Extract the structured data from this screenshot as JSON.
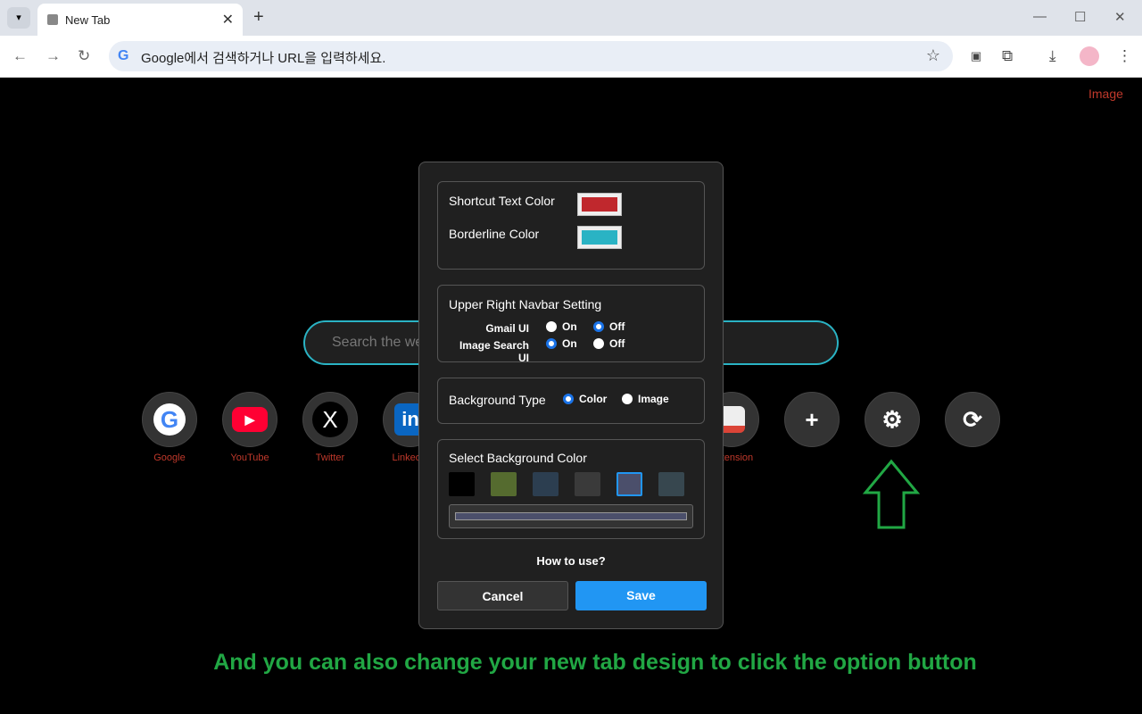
{
  "browser": {
    "tab_title": "New Tab",
    "omnibox_placeholder": "Google에서 검색하거나 URL을 입력하세요."
  },
  "page": {
    "image_link": "Image",
    "search_placeholder": "Search the web",
    "shortcuts": [
      {
        "label": "Google",
        "icon": "G",
        "color": "#fff"
      },
      {
        "label": "YouTube",
        "icon": "▶",
        "color": "#ff0033"
      },
      {
        "label": "Twitter",
        "icon": "X",
        "color": "#000"
      },
      {
        "label": "Linkedin",
        "icon": "in",
        "color": "#0a66c2"
      }
    ],
    "extension_label": "Extension",
    "add_icon": "+",
    "settings_icon": "⚙",
    "refresh_icon": "⟳"
  },
  "modal": {
    "shortcut_text_color_label": "Shortcut Text Color",
    "shortcut_text_color": "#c0282d",
    "borderline_color_label": "Borderline Color",
    "borderline_color": "#2ab3c4",
    "navbar_title": "Upper Right Navbar Setting",
    "gmail_label": "Gmail UI",
    "image_search_label": "Image Search UI",
    "on": "On",
    "off": "Off",
    "gmail_ui": "Off",
    "image_search_ui": "On",
    "background_type_label": "Background Type",
    "bg_color_option": "Color",
    "bg_image_option": "Image",
    "background_type": "Color",
    "select_bg_label": "Select Background Color",
    "swatches": [
      "#000000",
      "#556b2f",
      "#2c3e50",
      "#3a3a3a",
      "#4b4f6b",
      "#37474f"
    ],
    "selected_swatch": "#4b4f6b",
    "how_to": "How to use?",
    "cancel": "Cancel",
    "save": "Save"
  },
  "caption": "And you can also change your new tab design to click the option button",
  "colors": {
    "accent": "#2196f3",
    "annotation": "#21a744"
  }
}
